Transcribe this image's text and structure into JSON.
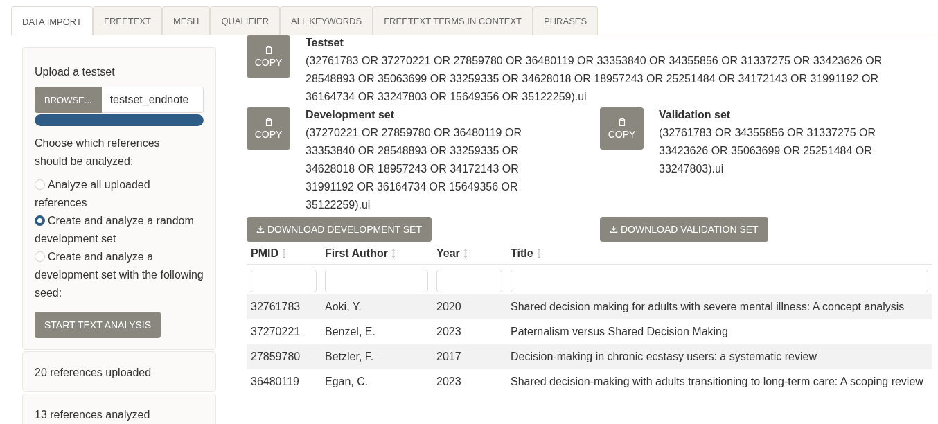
{
  "tabs": [
    {
      "label": "DATA IMPORT",
      "selected": true
    },
    {
      "label": "FREETEXT",
      "selected": false
    },
    {
      "label": "MESH",
      "selected": false
    },
    {
      "label": "QUALIFIER",
      "selected": false
    },
    {
      "label": "ALL KEYWORDS",
      "selected": false
    },
    {
      "label": "FREETEXT TERMS IN CONTEXT",
      "selected": false
    },
    {
      "label": "PHRASES",
      "selected": false
    }
  ],
  "sidebar": {
    "upload_label": "Upload a testset",
    "browse_button": "BROWSE...",
    "file_name": "testset_endnote",
    "upload_progress": {
      "level": 1
    },
    "choice_label": "Choose which references should be analyzed:",
    "options": [
      {
        "label": "Analyze all uploaded references",
        "selected": false
      },
      {
        "label": "Create and analyze a random development set",
        "selected": true
      },
      {
        "label": "Create and analyze a development set with the following seed:",
        "selected": false
      }
    ],
    "start_button": "START TEXT ANALYSIS",
    "info_panels": [
      "20 references uploaded",
      "13 references analyzed"
    ]
  },
  "testset": {
    "copy_button": "COPY",
    "title": "Testset",
    "query": "(32761783 OR 37270221 OR 27859780 OR 36480119 OR 33353840 OR 34355856 OR 31337275 OR 33423626 OR 28548893 OR 35063699 OR 33259335 OR 34628018 OR 18957243 OR 25251484 OR 34172143 OR 31991192 OR 36164734 OR 33247803 OR 15649356 OR 35122259).ui"
  },
  "sets": [
    {
      "copy_button": "COPY",
      "title": "Development set",
      "query": "(37270221 OR 27859780 OR 36480119 OR 33353840 OR 28548893 OR 33259335 OR 34628018 OR 18957243 OR 34172143 OR 31991192 OR 36164734 OR 15649356 OR 35122259).ui",
      "download_button": "DOWNLOAD DEVELOPMENT SET"
    },
    {
      "copy_button": "COPY",
      "title": "Validation set",
      "query": "(32761783 OR 34355856 OR 31337275 OR 33423626 OR 35063699 OR 25251484 OR 33247803).ui",
      "download_button": "DOWNLOAD VALIDATION SET"
    }
  ],
  "table": {
    "columns": [
      "PMID",
      "First Author",
      "Year",
      "Title"
    ],
    "rows": [
      [
        "32761783",
        "Aoki, Y.",
        "2020",
        "Shared decision making for adults with severe mental illness: A concept analysis"
      ],
      [
        "37270221",
        "Benzel, E.",
        "2023",
        "Paternalism versus Shared Decision Making"
      ],
      [
        "27859780",
        "Betzler, F.",
        "2017",
        "Decision-making in chronic ecstasy users: a systematic review"
      ],
      [
        "36480119",
        "Egan, C.",
        "2023",
        "Shared decision-making with adults transitioning to long-term care: A scoping review"
      ]
    ]
  }
}
